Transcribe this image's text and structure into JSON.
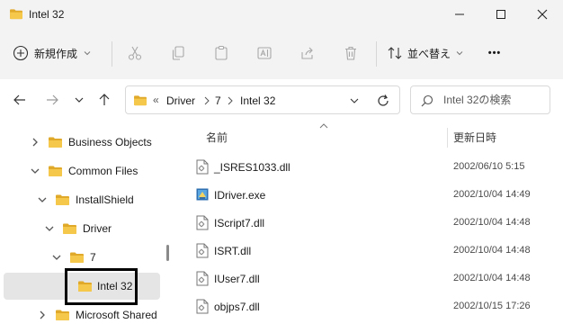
{
  "window": {
    "title": "Intel 32"
  },
  "cmdbar": {
    "new_label": "新規作成",
    "sort_label": "並べ替え",
    "more_label": "•••"
  },
  "address": {
    "overflow": "«",
    "crumbs": [
      "Driver",
      "7",
      "Intel 32"
    ]
  },
  "search": {
    "placeholder": "Intel 32の検索"
  },
  "tree": {
    "items": [
      {
        "label": "Business Objects",
        "state": "collapsed"
      },
      {
        "label": "Common Files",
        "state": "expanded"
      },
      {
        "label": "InstallShield",
        "state": "expanded"
      },
      {
        "label": "Driver",
        "state": "expanded"
      },
      {
        "label": "7",
        "state": "expanded"
      },
      {
        "label": "Intel 32",
        "state": "selected"
      },
      {
        "label": "Microsoft Shared",
        "state": "collapsed"
      }
    ]
  },
  "files": {
    "col_name": "名前",
    "col_date": "更新日時",
    "rows": [
      {
        "name": "_ISRES1033.dll",
        "date": "2002/06/10 5:15",
        "icon": "dll-file-icon"
      },
      {
        "name": "IDriver.exe",
        "date": "2002/10/04 14:49",
        "icon": "exe-app-icon"
      },
      {
        "name": "IScript7.dll",
        "date": "2002/10/04 14:48",
        "icon": "dll-file-icon"
      },
      {
        "name": "ISRT.dll",
        "date": "2002/10/04 14:48",
        "icon": "dll-file-icon"
      },
      {
        "name": "IUser7.dll",
        "date": "2002/10/04 14:48",
        "icon": "dll-file-icon"
      },
      {
        "name": "objps7.dll",
        "date": "2002/10/15 17:26",
        "icon": "dll-file-icon"
      }
    ]
  },
  "colors": {
    "folder": "#f2c14e",
    "folder_dark": "#e0a92a",
    "selected_bg": "#e5e5e5",
    "chrome_bg": "#f3f3f3"
  }
}
